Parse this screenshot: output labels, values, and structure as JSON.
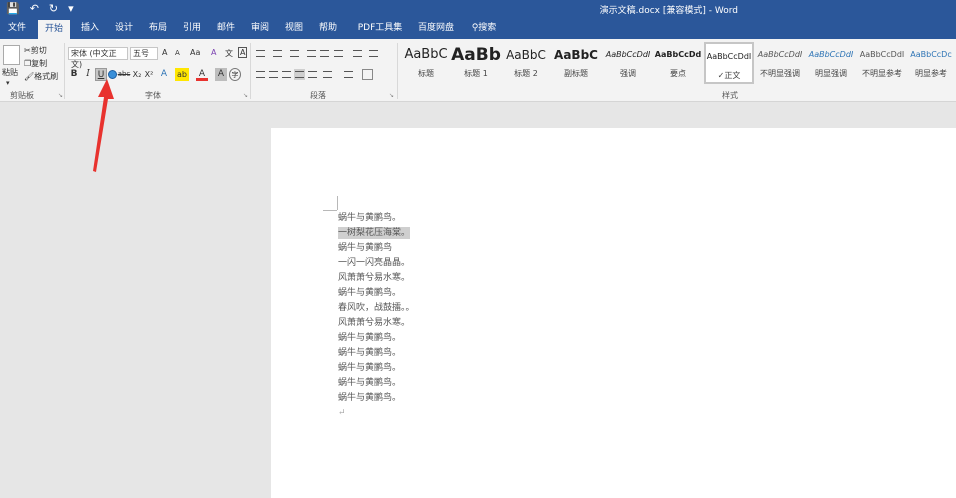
{
  "title_bar": {
    "window_title": "演示文稿.docx [兼容模式] - Word",
    "quick_access": {
      "save_icon": "save-icon",
      "undo_icon": "undo-icon",
      "redo_icon": "redo-icon",
      "customize_icon": "customize-qat-icon"
    }
  },
  "tabs": [
    {
      "label": "文件"
    },
    {
      "label": "开始"
    },
    {
      "label": "插入"
    },
    {
      "label": "设计"
    },
    {
      "label": "布局"
    },
    {
      "label": "引用"
    },
    {
      "label": "邮件"
    },
    {
      "label": "审阅"
    },
    {
      "label": "视图"
    },
    {
      "label": "帮助"
    },
    {
      "label": "PDF工具集"
    },
    {
      "label": "百度网盘"
    },
    {
      "label": "搜索"
    }
  ],
  "active_tab": "开始",
  "clipboard": {
    "group_label": "剪贴板",
    "paste": "粘贴",
    "cut": "剪切",
    "copy": "复制",
    "format_painter": "格式刷"
  },
  "font": {
    "group_label": "字体",
    "font_name": "宋体 (中文正文)",
    "font_size": "五号",
    "grow": "A",
    "shrink": "A",
    "change_case": "Aa",
    "clear_format": "A",
    "phonetic": "文",
    "border_char": "A",
    "bold": "B",
    "italic": "I",
    "underline": "U",
    "strikethrough": "abc",
    "subscript": "X₂",
    "superscript": "X²",
    "text_effects": "A",
    "highlight": "ab",
    "font_color": "A",
    "char_shading": "A",
    "enclose": "字"
  },
  "paragraph": {
    "group_label": "段落"
  },
  "styles": {
    "group_label": "样式",
    "items": [
      {
        "preview": "AaBbC",
        "name": "标题"
      },
      {
        "preview": "AaBb",
        "name": "标题 1"
      },
      {
        "preview": "AaBbC",
        "name": "标题 2"
      },
      {
        "preview": "AaBbC",
        "name": "副标题"
      },
      {
        "preview": "AaBbCcDdI",
        "name": "强调"
      },
      {
        "preview": "AaBbCcDd",
        "name": "要点"
      },
      {
        "preview": "AaBbCcDdI",
        "name": "正文"
      },
      {
        "preview": "AaBbCcDdI",
        "name": "不明显强调"
      },
      {
        "preview": "AaBbCcDdI",
        "name": "明显强调"
      },
      {
        "preview": "AaBbCcDdI",
        "name": "不明显参考"
      },
      {
        "preview": "AaBbCcDc",
        "name": "明显参考"
      }
    ],
    "current": "正文"
  },
  "document": {
    "lines": [
      "蜗牛与黄鹂鸟。",
      "一树梨花压海棠。",
      "蜗牛与黄鹂鸟",
      "一闪一闪亮晶晶。",
      "风萧萧兮易水寒。",
      "蜗牛与黄鹂鸟。",
      "春风吹，战鼓擂。。",
      "风萧萧兮易水寒。",
      "蜗牛与黄鹂鸟。",
      "蜗牛与黄鹂鸟。",
      "蜗牛与黄鹂鸟。",
      "蜗牛与黄鹂鸟。",
      "蜗牛与黄鹂鸟。"
    ],
    "highlighted_index": 1
  },
  "colors": {
    "ribbon_blue": "#2b579a",
    "ribbon_bg": "#f3f3f3",
    "annotation_arrow": "#e8322e",
    "heading2_preview": "#2e74b5",
    "intense_emphasis_preview": "#2e74b5"
  }
}
